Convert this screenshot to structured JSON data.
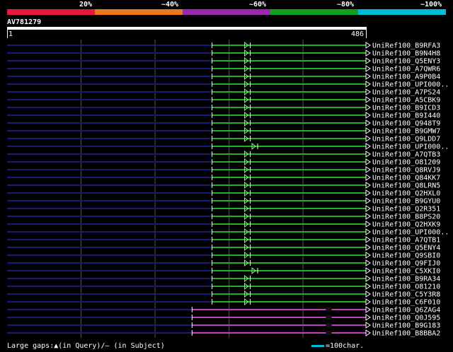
{
  "legend": {
    "segments": [
      {
        "color": "#e8193c",
        "label": "20%"
      },
      {
        "color": "#e8791e",
        "label": "~40%"
      },
      {
        "color": "#9c27b0",
        "label": "~60%"
      },
      {
        "color": "#11a11e",
        "label": "~80%"
      },
      {
        "color": "#00bcd4",
        "label": "~100%"
      }
    ]
  },
  "query": {
    "title": "AV781279",
    "start": "1",
    "end": "486",
    "length": 486
  },
  "hits": [
    {
      "label": "UniRef100_B9RFA3",
      "color": "#22b022",
      "start": 278,
      "end": 486,
      "gap": 322
    },
    {
      "label": "UniRef100_B9N4H8",
      "color": "#22b022",
      "start": 278,
      "end": 486,
      "gap": 322
    },
    {
      "label": "UniRef100_Q5ENY3",
      "color": "#22b022",
      "start": 278,
      "end": 486,
      "gap": 322
    },
    {
      "label": "UniRef100_A7QWR6",
      "color": "#22b022",
      "start": 278,
      "end": 486,
      "gap": 322
    },
    {
      "label": "UniRef100_A9P0B4",
      "color": "#22b022",
      "start": 278,
      "end": 486,
      "gap": 322
    },
    {
      "label": "UniRef100_UPI000..",
      "color": "#22b022",
      "start": 278,
      "end": 486,
      "gap": 322
    },
    {
      "label": "UniRef100_A7PS24",
      "color": "#22b022",
      "start": 278,
      "end": 486,
      "gap": 322
    },
    {
      "label": "UniRef100_A5CBK9",
      "color": "#22b022",
      "start": 278,
      "end": 486,
      "gap": 322
    },
    {
      "label": "UniRef100_B9ICD3",
      "color": "#22b022",
      "start": 278,
      "end": 486,
      "gap": 322
    },
    {
      "label": "UniRef100_B9I440",
      "color": "#22b022",
      "start": 278,
      "end": 486,
      "gap": 322
    },
    {
      "label": "UniRef100_Q948T9",
      "color": "#22b022",
      "start": 278,
      "end": 486,
      "gap": 322
    },
    {
      "label": "UniRef100_B9GMW7",
      "color": "#22b022",
      "start": 278,
      "end": 486,
      "gap": 322
    },
    {
      "label": "UniRef100_Q9LDD7",
      "color": "#22b022",
      "start": 278,
      "end": 486,
      "gap": 322
    },
    {
      "label": "UniRef100_UPI000..",
      "color": "#22b022",
      "start": 278,
      "end": 486,
      "gap": 332
    },
    {
      "label": "UniRef100_A7QTB3",
      "color": "#22b022",
      "start": 278,
      "end": 486,
      "gap": 322
    },
    {
      "label": "UniRef100_O81209",
      "color": "#22b022",
      "start": 278,
      "end": 486,
      "gap": 322
    },
    {
      "label": "UniRef100_Q8RVJ9",
      "color": "#22b022",
      "start": 278,
      "end": 486,
      "gap": 322
    },
    {
      "label": "UniRef100_Q84KK7",
      "color": "#22b022",
      "start": 278,
      "end": 486,
      "gap": 322
    },
    {
      "label": "UniRef100_Q8LRN5",
      "color": "#22b022",
      "start": 278,
      "end": 486,
      "gap": 322
    },
    {
      "label": "UniRef100_Q2HXL0",
      "color": "#22b022",
      "start": 278,
      "end": 486,
      "gap": 322
    },
    {
      "label": "UniRef100_B9GYU0",
      "color": "#22b022",
      "start": 278,
      "end": 486,
      "gap": 322
    },
    {
      "label": "UniRef100_Q2R351",
      "color": "#22b022",
      "start": 278,
      "end": 486,
      "gap": 322
    },
    {
      "label": "UniRef100_B8PS20",
      "color": "#22b022",
      "start": 278,
      "end": 486,
      "gap": 322
    },
    {
      "label": "UniRef100_Q2HXK9",
      "color": "#22b022",
      "start": 278,
      "end": 486,
      "gap": 322
    },
    {
      "label": "UniRef100_UPI000..",
      "color": "#22b022",
      "start": 278,
      "end": 486,
      "gap": 322
    },
    {
      "label": "UniRef100_A7QTB1",
      "color": "#22b022",
      "start": 278,
      "end": 486,
      "gap": 322
    },
    {
      "label": "UniRef100_Q5ENY4",
      "color": "#22b022",
      "start": 278,
      "end": 486,
      "gap": 322
    },
    {
      "label": "UniRef100_Q9SBI0",
      "color": "#22b022",
      "start": 278,
      "end": 486,
      "gap": 322
    },
    {
      "label": "UniRef100_Q9FIJ0",
      "color": "#22b022",
      "start": 278,
      "end": 486,
      "gap": 322
    },
    {
      "label": "UniRef100_C5XKI0",
      "color": "#22b022",
      "start": 278,
      "end": 486,
      "gap": 332
    },
    {
      "label": "UniRef100_B9RA34",
      "color": "#22b022",
      "start": 278,
      "end": 486,
      "gap": 322
    },
    {
      "label": "UniRef100_O81210",
      "color": "#22b022",
      "start": 278,
      "end": 486,
      "gap": 322
    },
    {
      "label": "UniRef100_C5Y3R8",
      "color": "#22b022",
      "start": 278,
      "end": 486,
      "gap": 322
    },
    {
      "label": "UniRef100_C6F010",
      "color": "#22b022",
      "start": 278,
      "end": 486,
      "gap": 322
    },
    {
      "label": "UniRef100_Q6ZAG4",
      "color": "#c040c0",
      "start": 251,
      "end": 486,
      "gap": 432
    },
    {
      "label": "UniRef100_Q0J595",
      "color": "#c040c0",
      "start": 251,
      "end": 486,
      "gap": 432
    },
    {
      "label": "UniRef100_B9G183",
      "color": "#c040c0",
      "start": 251,
      "end": 486,
      "gap": 432
    },
    {
      "label": "UniRef100_B8BBA2",
      "color": "#c040c0",
      "start": 251,
      "end": 486,
      "gap": 432
    }
  ],
  "footer": {
    "gaps_text": "Large gaps:▲(in Query)/— (in Subject)",
    "scale_text": "=100char."
  }
}
